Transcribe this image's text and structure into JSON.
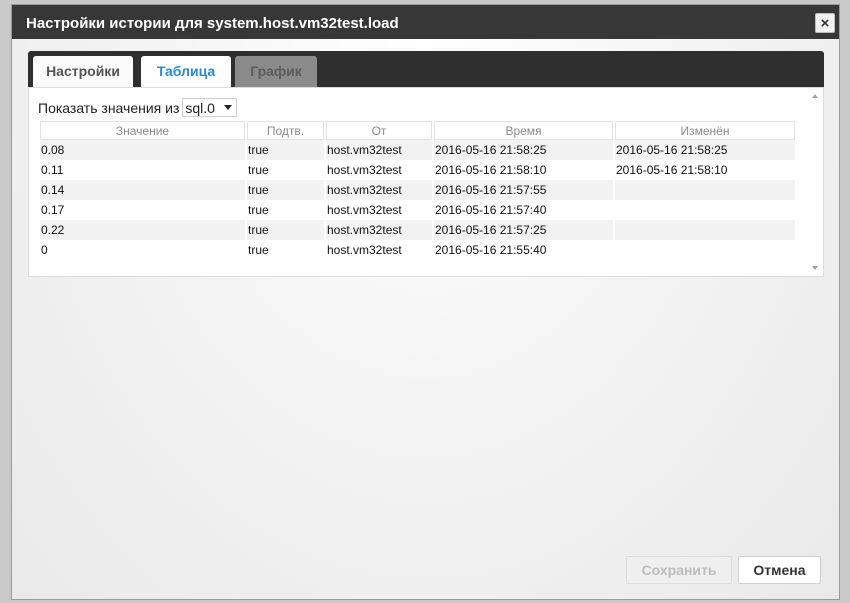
{
  "dialog": {
    "title": "Настройки истории для system.host.vm32test.load",
    "close_icon": "×"
  },
  "tabs": [
    {
      "label": "Настройки",
      "state": "inactive"
    },
    {
      "label": "Таблица",
      "state": "active"
    },
    {
      "label": "График",
      "state": "disabled"
    }
  ],
  "source": {
    "label": "Показать значения из",
    "selected": "sql.0"
  },
  "table": {
    "columns": [
      "Значение",
      "Подтв.",
      "От",
      "Время",
      "Изменён"
    ],
    "rows": [
      {
        "value": "0.08",
        "ack": "true",
        "from": "host.vm32test",
        "time": "2016-05-16 21:58:25",
        "changed": "2016-05-16 21:58:25"
      },
      {
        "value": "0.11",
        "ack": "true",
        "from": "host.vm32test",
        "time": "2016-05-16 21:58:10",
        "changed": "2016-05-16 21:58:10"
      },
      {
        "value": "0.14",
        "ack": "true",
        "from": "host.vm32test",
        "time": "2016-05-16 21:57:55",
        "changed": ""
      },
      {
        "value": "0.17",
        "ack": "true",
        "from": "host.vm32test",
        "time": "2016-05-16 21:57:40",
        "changed": ""
      },
      {
        "value": "0.22",
        "ack": "true",
        "from": "host.vm32test",
        "time": "2016-05-16 21:57:25",
        "changed": ""
      },
      {
        "value": "0",
        "ack": "true",
        "from": "host.vm32test",
        "time": "2016-05-16 21:55:40",
        "changed": ""
      }
    ]
  },
  "buttons": {
    "save": "Сохранить",
    "cancel": "Отмена"
  },
  "colors": {
    "titlebar": "#373737",
    "active_tab_text": "#2a8bd2"
  }
}
